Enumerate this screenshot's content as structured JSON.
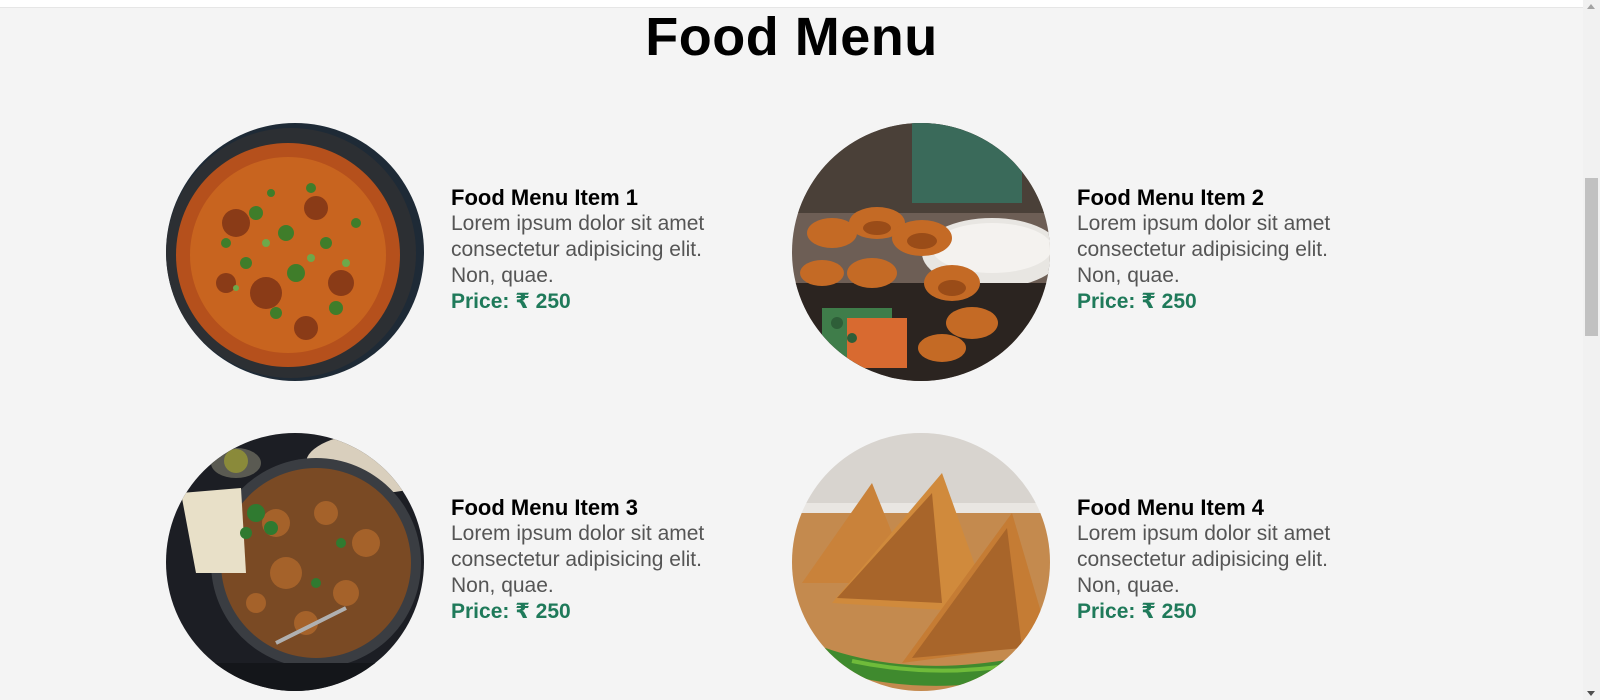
{
  "page": {
    "title": "Food Menu"
  },
  "items": [
    {
      "name": "Food Menu Item 1",
      "description": "Lorem ipsum dolor sit amet consectetur adipisicing elit. Non, quae.",
      "price": "Price: ₹ 250"
    },
    {
      "name": "Food Menu Item 2",
      "description": "Lorem ipsum dolor sit amet consectetur adipisicing elit. Non, quae.",
      "price": "Price: ₹ 250"
    },
    {
      "name": "Food Menu Item 3",
      "description": "Lorem ipsum dolor sit amet consectetur adipisicing elit. Non, quae.",
      "price": "Price: ₹ 250"
    },
    {
      "name": "Food Menu Item 4",
      "description": "Lorem ipsum dolor sit amet consectetur adipisicing elit. Non, quae.",
      "price": "Price: ₹ 250"
    }
  ],
  "colors": {
    "background": "#f4f4f4",
    "price": "#1f7a5a",
    "title": "#000000",
    "description": "#555555"
  }
}
